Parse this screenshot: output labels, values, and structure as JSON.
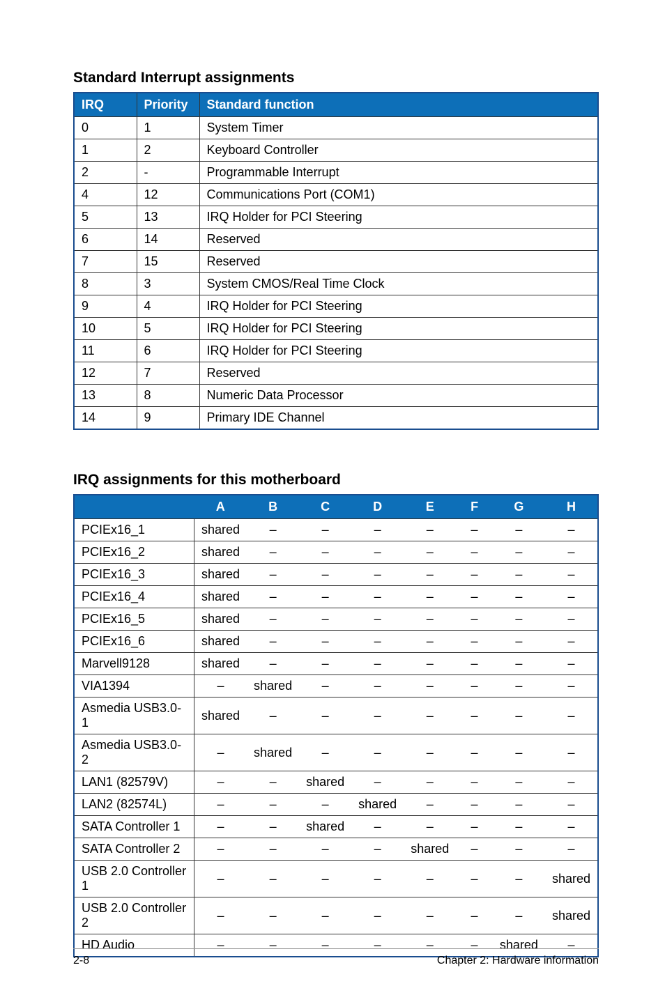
{
  "titles": {
    "table1": "Standard Interrupt assignments",
    "table2": "IRQ assignments for this motherboard"
  },
  "table1": {
    "headers": {
      "irq": "IRQ",
      "priority": "Priority",
      "func": "Standard function"
    },
    "rows": [
      {
        "irq": "0",
        "priority": "1",
        "func": "System Timer"
      },
      {
        "irq": "1",
        "priority": "2",
        "func": "Keyboard Controller"
      },
      {
        "irq": "2",
        "priority": "-",
        "func": "Programmable Interrupt"
      },
      {
        "irq": "4",
        "priority": "12",
        "func": "Communications Port (COM1)"
      },
      {
        "irq": "5",
        "priority": "13",
        "func": "IRQ Holder for PCI Steering"
      },
      {
        "irq": "6",
        "priority": "14",
        "func": "Reserved"
      },
      {
        "irq": "7",
        "priority": "15",
        "func": "Reserved"
      },
      {
        "irq": "8",
        "priority": "3",
        "func": "System CMOS/Real Time Clock"
      },
      {
        "irq": "9",
        "priority": "4",
        "func": "IRQ Holder for PCI Steering"
      },
      {
        "irq": "10",
        "priority": "5",
        "func": "IRQ Holder for PCI Steering"
      },
      {
        "irq": "11",
        "priority": "6",
        "func": "IRQ Holder for PCI Steering"
      },
      {
        "irq": "12",
        "priority": "7",
        "func": "Reserved"
      },
      {
        "irq": "13",
        "priority": "8",
        "func": "Numeric Data Processor"
      },
      {
        "irq": "14",
        "priority": "9",
        "func": "Primary IDE Channel"
      }
    ]
  },
  "table2": {
    "headers": [
      "",
      "A",
      "B",
      "C",
      "D",
      "E",
      "F",
      "G",
      "H"
    ],
    "rows": [
      {
        "name": "PCIEx16_1",
        "cells": [
          "shared",
          "–",
          "–",
          "–",
          "–",
          "–",
          "–",
          "–"
        ]
      },
      {
        "name": "PCIEx16_2",
        "cells": [
          "shared",
          "–",
          "–",
          "–",
          "–",
          "–",
          "–",
          "–"
        ]
      },
      {
        "name": "PCIEx16_3",
        "cells": [
          "shared",
          "–",
          "–",
          "–",
          "–",
          "–",
          "–",
          "–"
        ]
      },
      {
        "name": "PCIEx16_4",
        "cells": [
          "shared",
          "–",
          "–",
          "–",
          "–",
          "–",
          "–",
          "–"
        ]
      },
      {
        "name": "PCIEx16_5",
        "cells": [
          "shared",
          "–",
          "–",
          "–",
          "–",
          "–",
          "–",
          "–"
        ]
      },
      {
        "name": "PCIEx16_6",
        "cells": [
          "shared",
          "–",
          "–",
          "–",
          "–",
          "–",
          "–",
          "–"
        ]
      },
      {
        "name": "Marvell9128",
        "cells": [
          "shared",
          "–",
          "–",
          "–",
          "–",
          "–",
          "–",
          "–"
        ]
      },
      {
        "name": "VIA1394",
        "cells": [
          "–",
          "shared",
          "–",
          "–",
          "–",
          "–",
          "–",
          "–"
        ]
      },
      {
        "name": "Asmedia USB3.0-1",
        "cells": [
          "shared",
          "–",
          "–",
          "–",
          "–",
          "–",
          "–",
          "–"
        ]
      },
      {
        "name": "Asmedia USB3.0-2",
        "cells": [
          "–",
          "shared",
          "–",
          "–",
          "–",
          "–",
          "–",
          "–"
        ]
      },
      {
        "name": "LAN1 (82579V)",
        "cells": [
          "–",
          "–",
          "shared",
          "–",
          "–",
          "–",
          "–",
          "–"
        ]
      },
      {
        "name": "LAN2 (82574L)",
        "cells": [
          "–",
          "–",
          "–",
          "shared",
          "–",
          "–",
          "–",
          "–"
        ]
      },
      {
        "name": "SATA Controller 1",
        "cells": [
          "–",
          "–",
          "shared",
          "–",
          "–",
          "–",
          "–",
          "–"
        ]
      },
      {
        "name": "SATA Controller 2",
        "cells": [
          "–",
          "–",
          "–",
          "–",
          "shared",
          "–",
          "–",
          "–"
        ]
      },
      {
        "name": "USB 2.0 Controller 1",
        "cells": [
          "–",
          "–",
          "–",
          "–",
          "–",
          "–",
          "–",
          "shared"
        ]
      },
      {
        "name": "USB 2.0 Controller 2",
        "cells": [
          "–",
          "–",
          "–",
          "–",
          "–",
          "–",
          "–",
          "shared"
        ]
      },
      {
        "name": "HD Audio",
        "cells": [
          "–",
          "–",
          "–",
          "–",
          "–",
          "–",
          "shared",
          "–"
        ]
      }
    ]
  },
  "footer": {
    "page": "2-8",
    "chapter": "Chapter 2: Hardware information"
  }
}
